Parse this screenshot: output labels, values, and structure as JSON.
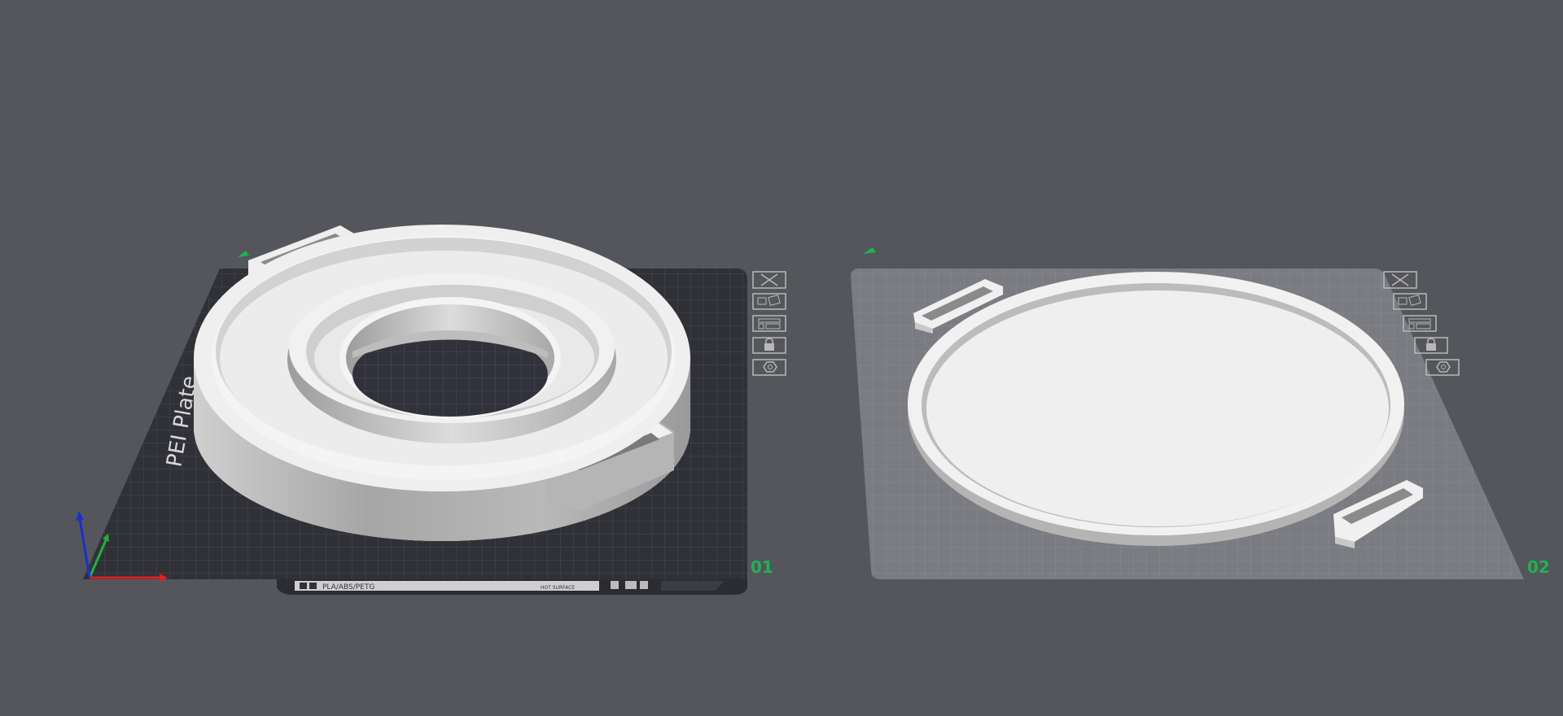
{
  "scene": {
    "background": "#55565b",
    "accent": "#1db350"
  },
  "plates": [
    {
      "number": "01",
      "selected": true,
      "bed_texture_label": "PEI Plate",
      "bed_strip": {
        "material": "PLA/ABS/PETG",
        "surface": "HOT SURFACE"
      },
      "object": "ring-adapter"
    },
    {
      "number": "02",
      "selected": false,
      "object": "round-lid"
    }
  ],
  "plate_toolbar_icons": [
    "close-icon",
    "arrange-icon",
    "orient-icon",
    "lock-icon",
    "settings-icon"
  ],
  "axes": {
    "x_color": "#e02020",
    "y_color": "#20b040",
    "z_color": "#1a2fd0"
  }
}
